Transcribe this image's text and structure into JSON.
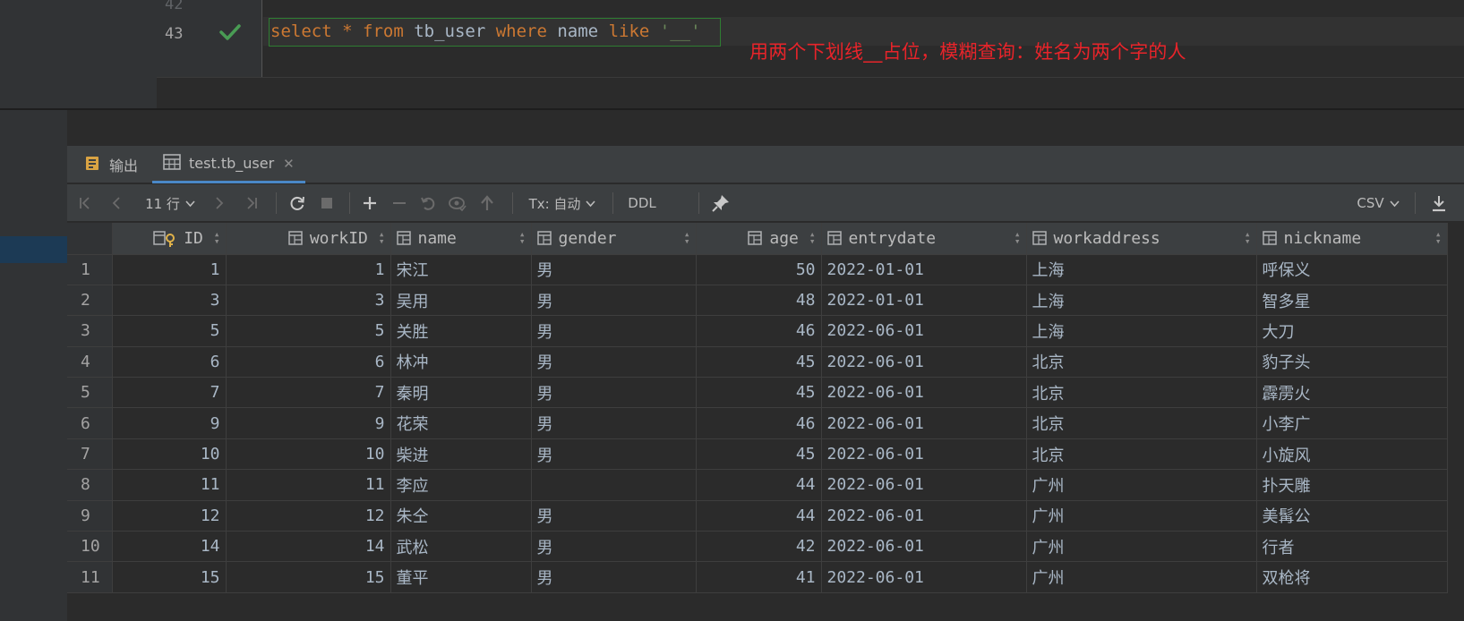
{
  "editor": {
    "line_prev": "42",
    "line_current": "43",
    "sql_tokens": [
      {
        "t": "select",
        "c": "kw"
      },
      {
        "t": " ",
        "c": "id"
      },
      {
        "t": "*",
        "c": "kw"
      },
      {
        "t": " ",
        "c": "id"
      },
      {
        "t": "from",
        "c": "kw"
      },
      {
        "t": " tb_user ",
        "c": "id"
      },
      {
        "t": "where",
        "c": "kw"
      },
      {
        "t": " name ",
        "c": "id"
      },
      {
        "t": "like",
        "c": "kw"
      },
      {
        "t": " ",
        "c": "id"
      },
      {
        "t": "'__'",
        "c": "str"
      }
    ],
    "annotation": "用两个下划线__占位，模糊查询：姓名为两个字的人",
    "status_icon": "check-icon"
  },
  "tabs": {
    "output_label": "输出",
    "table_label": "test.tb_user"
  },
  "toolbar": {
    "row_count": "11 行",
    "tx_mode": "Tx: 自动",
    "ddl_label": "DDL",
    "export_format": "CSV"
  },
  "grid": {
    "columns": [
      "ID",
      "workID",
      "name",
      "gender",
      "age",
      "entrydate",
      "workaddress",
      "nickname"
    ],
    "rows": [
      [
        "1",
        "1",
        "1",
        "宋江",
        "男",
        "50",
        "2022-01-01",
        "上海",
        "呼保义"
      ],
      [
        "2",
        "3",
        "3",
        "吴用",
        "男",
        "48",
        "2022-01-01",
        "上海",
        "智多星"
      ],
      [
        "3",
        "5",
        "5",
        "关胜",
        "男",
        "46",
        "2022-06-01",
        "上海",
        "大刀"
      ],
      [
        "4",
        "6",
        "6",
        "林冲",
        "男",
        "45",
        "2022-06-01",
        "北京",
        "豹子头"
      ],
      [
        "5",
        "7",
        "7",
        "秦明",
        "男",
        "45",
        "2022-06-01",
        "北京",
        "霹雳火"
      ],
      [
        "6",
        "9",
        "9",
        "花荣",
        "男",
        "46",
        "2022-06-01",
        "北京",
        "小李广"
      ],
      [
        "7",
        "10",
        "10",
        "柴进",
        "男",
        "45",
        "2022-06-01",
        "北京",
        "小旋风"
      ],
      [
        "8",
        "11",
        "11",
        "李应",
        "",
        "44",
        "2022-06-01",
        "广州",
        "扑天雕"
      ],
      [
        "9",
        "12",
        "12",
        "朱仝",
        "男",
        "44",
        "2022-06-01",
        "广州",
        "美髯公"
      ],
      [
        "10",
        "14",
        "14",
        "武松",
        "男",
        "42",
        "2022-06-01",
        "广州",
        "行者"
      ],
      [
        "11",
        "15",
        "15",
        "董平",
        "男",
        "41",
        "2022-06-01",
        "广州",
        "双枪将"
      ]
    ]
  },
  "colors": {
    "keyword": "#cc7832",
    "string": "#6a8759",
    "annotation": "#e8242a",
    "success": "#499c54"
  }
}
